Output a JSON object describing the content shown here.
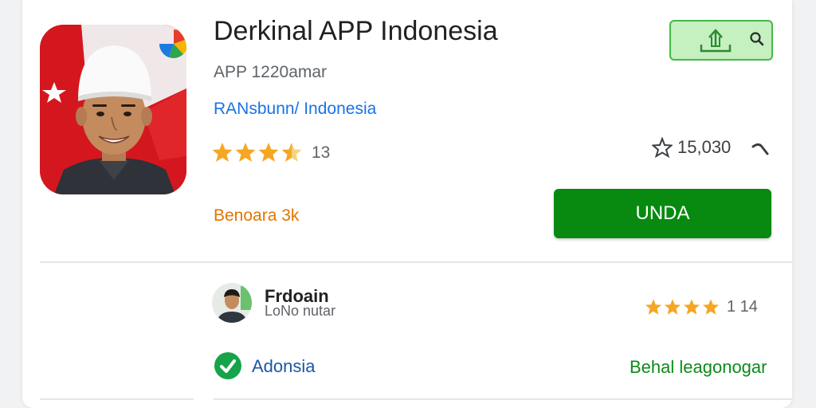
{
  "app": {
    "title": "Derkinal APP Indonesia",
    "subtitle": "APP 1220amar",
    "developer": "RANsbunn/ Indonesia",
    "rating_count": "13",
    "rating_stars": 3.5,
    "favorites": "15,030",
    "size_label": "Benoara 3k",
    "install_label": "UNDA"
  },
  "review": {
    "name": "Frdoain",
    "subtitle": "LoNo nutar",
    "rating_stars": 4,
    "count": "1 14"
  },
  "footer": {
    "badge_label": "Adonsia",
    "right_link": "Behal leagonogar"
  },
  "colors": {
    "install_green": "#078a0f",
    "star": "#f5a623",
    "link_blue": "#1a73e8",
    "size_orange": "#e37400",
    "share_bg": "#c5f0c0"
  },
  "icons": {
    "share": "upload-icon",
    "search": "search-icon",
    "favorite": "star-outline-icon",
    "curl": "curl-arrow-icon",
    "badge": "check-badge-icon"
  }
}
